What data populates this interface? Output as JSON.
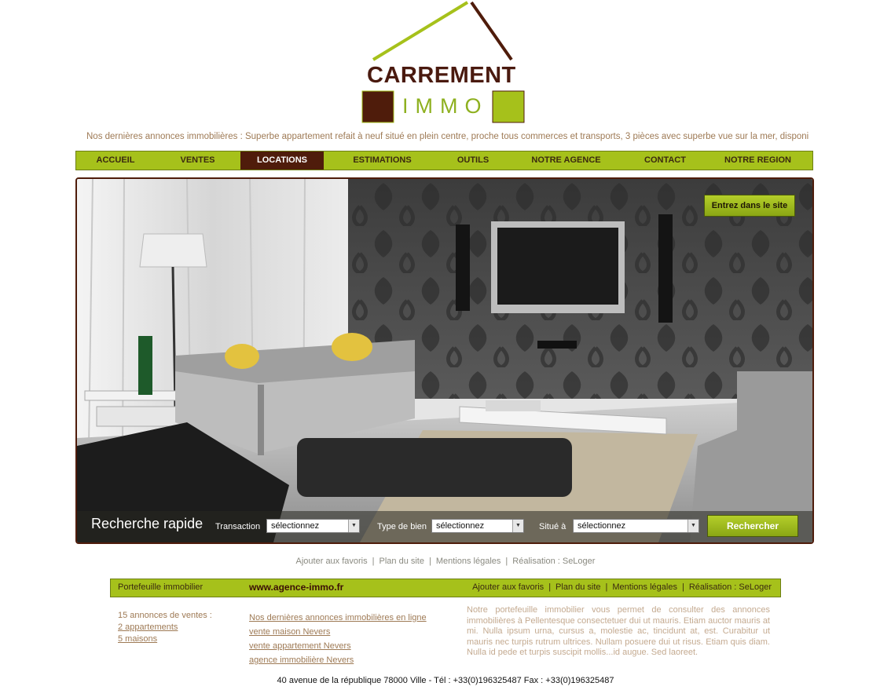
{
  "logo": {
    "word1": "CARREMENT",
    "word2": "IMMO",
    "colors": {
      "brown": "#4f1c0b",
      "green": "#a6c11b"
    }
  },
  "ticker": "Nos dernières annonces immobilières : Superbe appartement  refait à neuf situé en plein centre, proche tous commerces et transports, 3 pièces avec superbe vue sur la mer, disponible à ...",
  "nav": {
    "items": [
      {
        "label": "ACCUEIL"
      },
      {
        "label": "VENTES"
      },
      {
        "label": "LOCATIONS",
        "active": true
      },
      {
        "label": "ESTIMATIONS"
      },
      {
        "label": "OUTILS"
      },
      {
        "label": "NOTRE AGENCE"
      },
      {
        "label": "CONTACT"
      },
      {
        "label": "NOTRE REGION"
      }
    ]
  },
  "hero": {
    "enter_label": "Entrez dans le site",
    "search": {
      "title": "Recherche rapide",
      "transaction_label": "Transaction",
      "transaction_value": "sélectionnez",
      "type_label": "Type de bien",
      "type_value": "sélectionnez",
      "situe_label": "Situé à",
      "situe_value": "sélectionnez",
      "button_label": "Rechercher"
    }
  },
  "footer_links": {
    "favoris": "Ajouter aux favoris",
    "plan": "Plan du site",
    "mentions": "Mentions légales",
    "realisation": "Réalisation : SeLoger"
  },
  "bottom_bar": {
    "left": "Portefeuille immobilier",
    "url": "www.agence-immo.fr",
    "favoris": "Ajouter aux favoris",
    "plan": "Plan du site",
    "mentions": "Mentions légales",
    "realisation": "Réalisation : SeLoger"
  },
  "col1": {
    "title": "15 annonces de ventes :",
    "links": [
      "2 appartements",
      "5 maisons"
    ]
  },
  "col2": {
    "links": [
      "Nos dernières annonces immobilières en ligne",
      "vente maison Nevers",
      "vente appartement Nevers",
      "agence immobilière Nevers"
    ]
  },
  "col3": {
    "text": "Notre portefeuille immobilier vous permet de consulter des annonces immobilières à Pellentesque consectetuer dui ut mauris. Etiam auctor mauris at mi. Nulla ipsum urna, cursus a, molestie ac, tincidunt at, est. Curabitur ut mauris nec turpis rutrum ultrices. Nullam posuere dui ut risus. Etiam quis diam. Nulla id pede et turpis suscipit mollis...id augue. Sed laoreet."
  },
  "address": "40 avenue de la république  78000 Ville   -   Tél : +33(0)196325487 Fax : +33(0)196325487"
}
